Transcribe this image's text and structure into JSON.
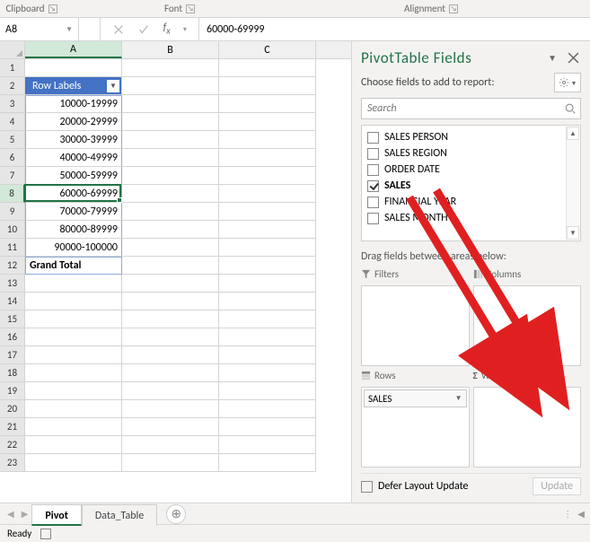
{
  "ribbon": {
    "clipboard": "Clipboard",
    "font": "Font",
    "alignment": "Alignment"
  },
  "namebox": "A8",
  "formula": "60000-69999",
  "columns": {
    "a": "A",
    "b": "B",
    "c": "C"
  },
  "rows": [
    "1",
    "2",
    "3",
    "4",
    "5",
    "6",
    "7",
    "8",
    "9",
    "10",
    "11",
    "12",
    "13",
    "14",
    "15",
    "16",
    "17",
    "18",
    "19",
    "20",
    "21",
    "22",
    "23"
  ],
  "pivot": {
    "header": "Row Labels",
    "items": [
      "10000-19999",
      "20000-29999",
      "30000-39999",
      "40000-49999",
      "50000-59999",
      "60000-69999",
      "70000-79999",
      "80000-89999",
      "90000-100000"
    ],
    "total": "Grand Total"
  },
  "pane": {
    "title": "PivotTable Fields",
    "choose": "Choose fields to add to report:",
    "searchPlaceholder": "Search",
    "fields": [
      {
        "label": "SALES PERSON",
        "checked": false
      },
      {
        "label": "SALES REGION",
        "checked": false
      },
      {
        "label": "ORDER DATE",
        "checked": false
      },
      {
        "label": "SALES",
        "checked": true
      },
      {
        "label": "FINANCIAL YEAR",
        "checked": false
      },
      {
        "label": "SALES MONTH",
        "checked": false
      }
    ],
    "drag": "Drag fields between areas below:",
    "filters": "Filters",
    "columnsArea": "Columns",
    "rowsArea": "Rows",
    "valuesArea": "Values",
    "rowChip": "SALES",
    "defer": "Defer Layout Update",
    "update": "Update"
  },
  "tabs": {
    "active": "Pivot",
    "other": "Data_Table"
  },
  "status": "Ready"
}
